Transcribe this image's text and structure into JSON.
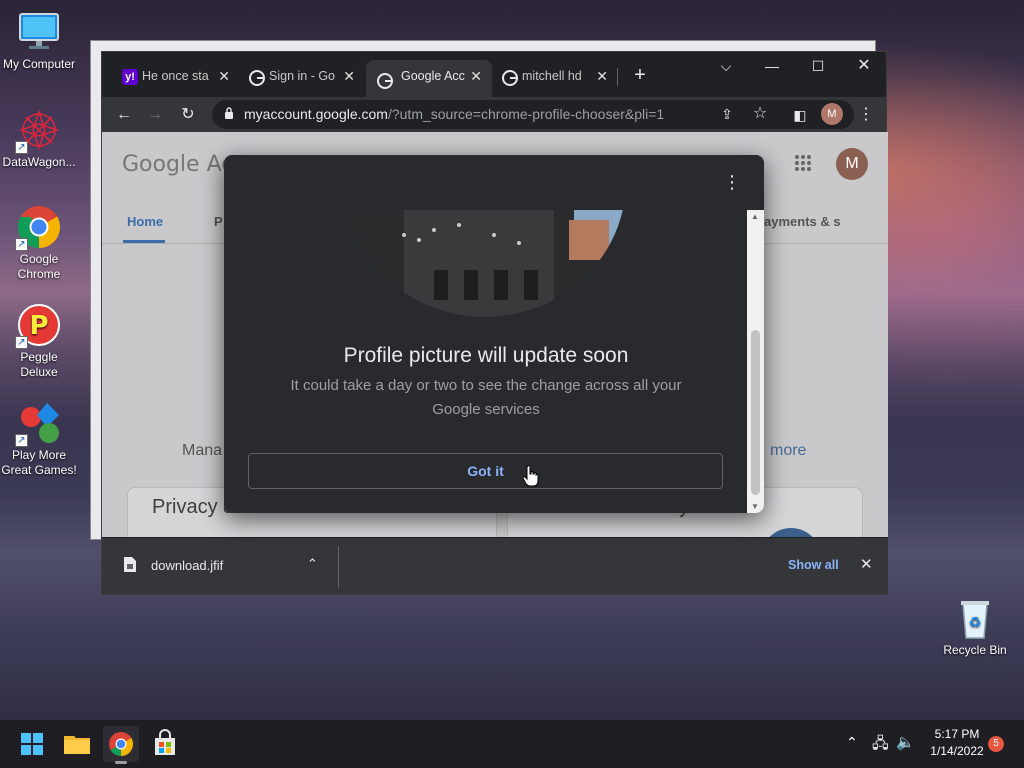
{
  "desktop": {
    "icons": [
      {
        "label": "My Computer",
        "icon": "monitor-icon"
      },
      {
        "label": "DataWagon...",
        "icon": "datawagon-icon"
      },
      {
        "label": "Google Chrome",
        "icon": "chrome-icon"
      },
      {
        "label": "Peggle Deluxe",
        "icon": "peggle-icon"
      },
      {
        "label": "Play More Great Games!",
        "icon": "games-icon"
      },
      {
        "label": "Recycle Bin",
        "icon": "recycle-bin-icon"
      }
    ]
  },
  "browser": {
    "tabs": [
      {
        "title": "He once sta",
        "icon": "yahoo-icon"
      },
      {
        "title": "Sign in - Go",
        "icon": "google-icon"
      },
      {
        "title": "Google Acc",
        "icon": "google-icon",
        "active": true
      },
      {
        "title": "mitchell hd",
        "icon": "google-icon"
      }
    ],
    "new_tab": "+",
    "url_host": "myaccount.google.com",
    "url_path": "/?utm_source=chrome-profile-chooser&pli=1",
    "profile_initial": "M"
  },
  "page": {
    "logo_text": "Google Ac",
    "nav": {
      "home": "Home",
      "personal": "P",
      "payments": "ayments & s"
    },
    "manage_text": "Mana",
    "more_link": "more",
    "card_left_title": "Privacy &",
    "card_right_title": "You have security",
    "account_initial": "M"
  },
  "dialog": {
    "heading": "Profile picture will update soon",
    "subtext": "It could take a day or two to see the change across all your Google services",
    "button": "Got it"
  },
  "download_bar": {
    "file_name": "download.jfif",
    "show_all": "Show all"
  },
  "taskbar": {
    "time": "5:17 PM",
    "date": "1/14/2022",
    "notification_count": "5"
  }
}
